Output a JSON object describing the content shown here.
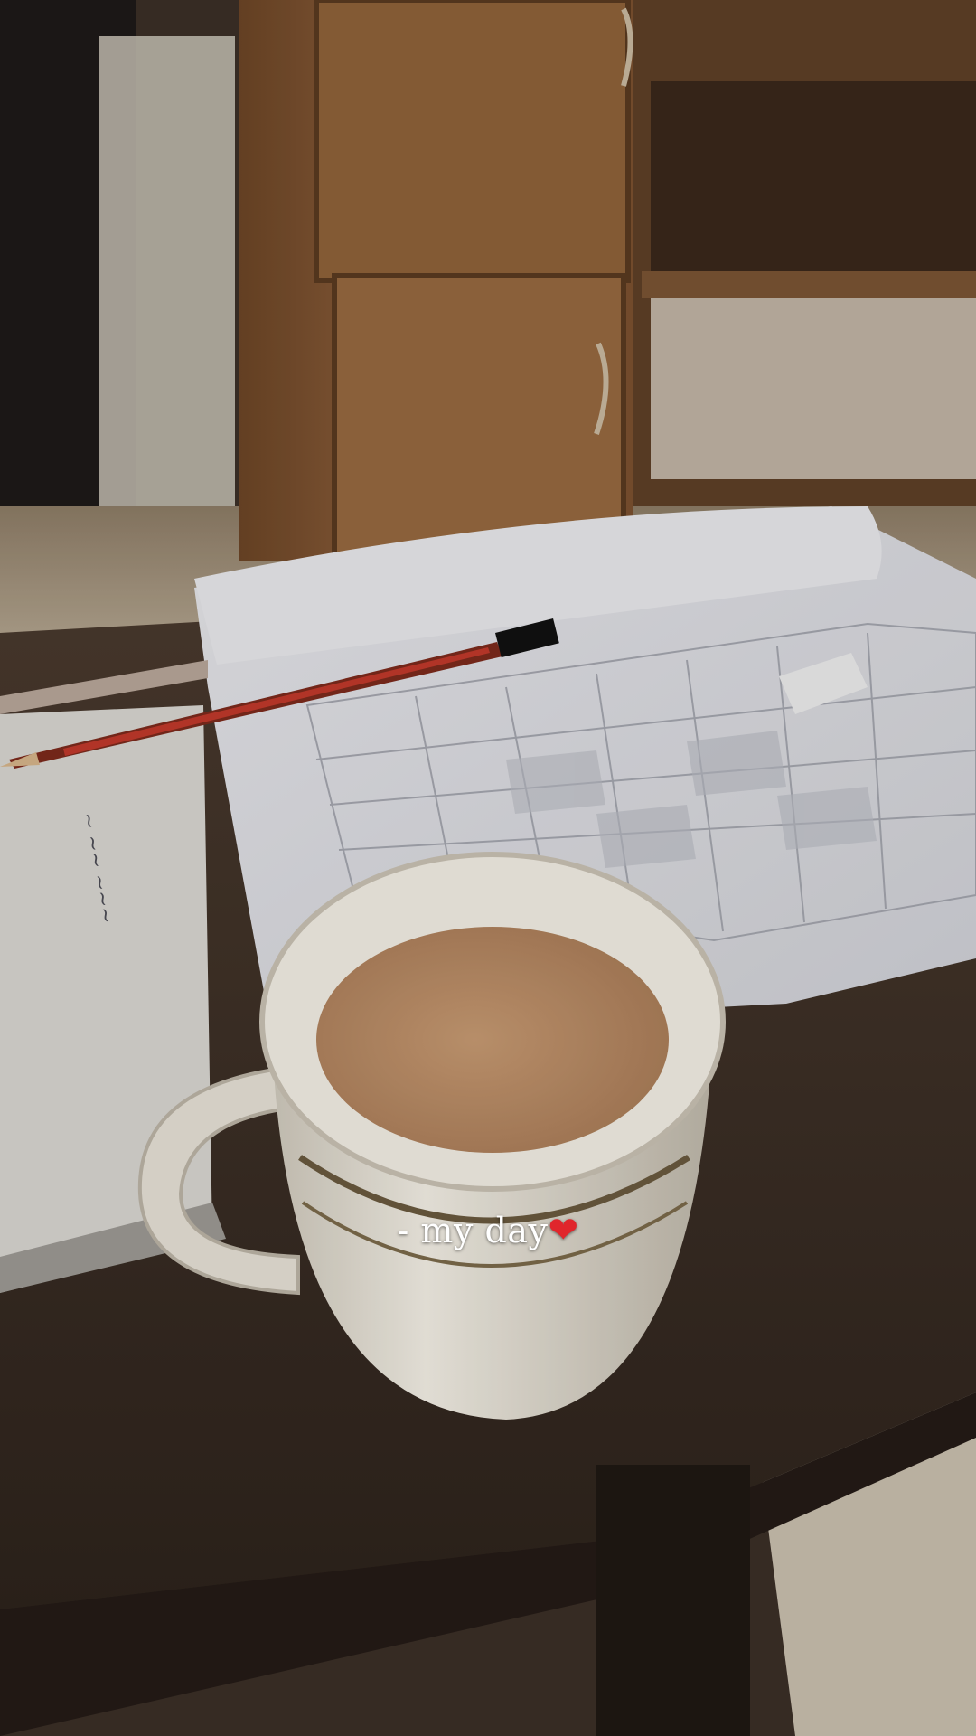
{
  "story": {
    "caption": "- my day",
    "caption_emoji": "❤"
  },
  "colors": {
    "caption_text": "#ffffff",
    "heart": "#e0262c",
    "tea": "#b88c66",
    "cabinet": "#8a5e39",
    "table": "#3b2d24",
    "mug": "#ece8de"
  }
}
